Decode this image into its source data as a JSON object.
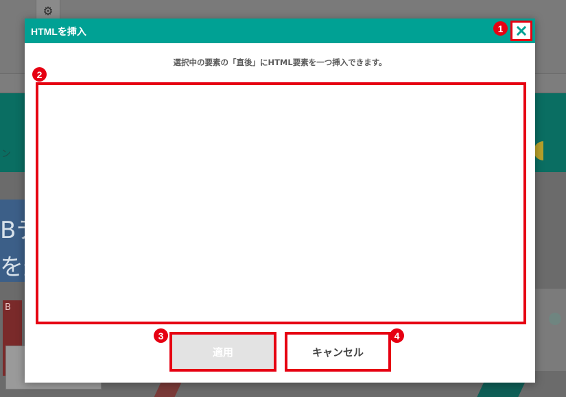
{
  "background": {
    "settings_icon": "gear-icon",
    "hero_text_line1": "Bテ",
    "hero_text_line2": "を最",
    "hero_small_text": "ン",
    "thumb_letter": "B"
  },
  "dialog": {
    "title": "HTMLを挿入",
    "close_icon": "close-icon",
    "description": "選択中の要素の「直後」にHTML要素を一つ挿入できます。",
    "textarea_value": "",
    "apply_label": "適用",
    "cancel_label": "キャンセル",
    "apply_disabled": true
  },
  "annotations": {
    "marker_1": "1",
    "marker_2": "2",
    "marker_3": "3",
    "marker_4": "4"
  },
  "colors": {
    "header": "#00a194",
    "annotation_red": "#e60012",
    "disabled_button": "#e3e3e3"
  }
}
